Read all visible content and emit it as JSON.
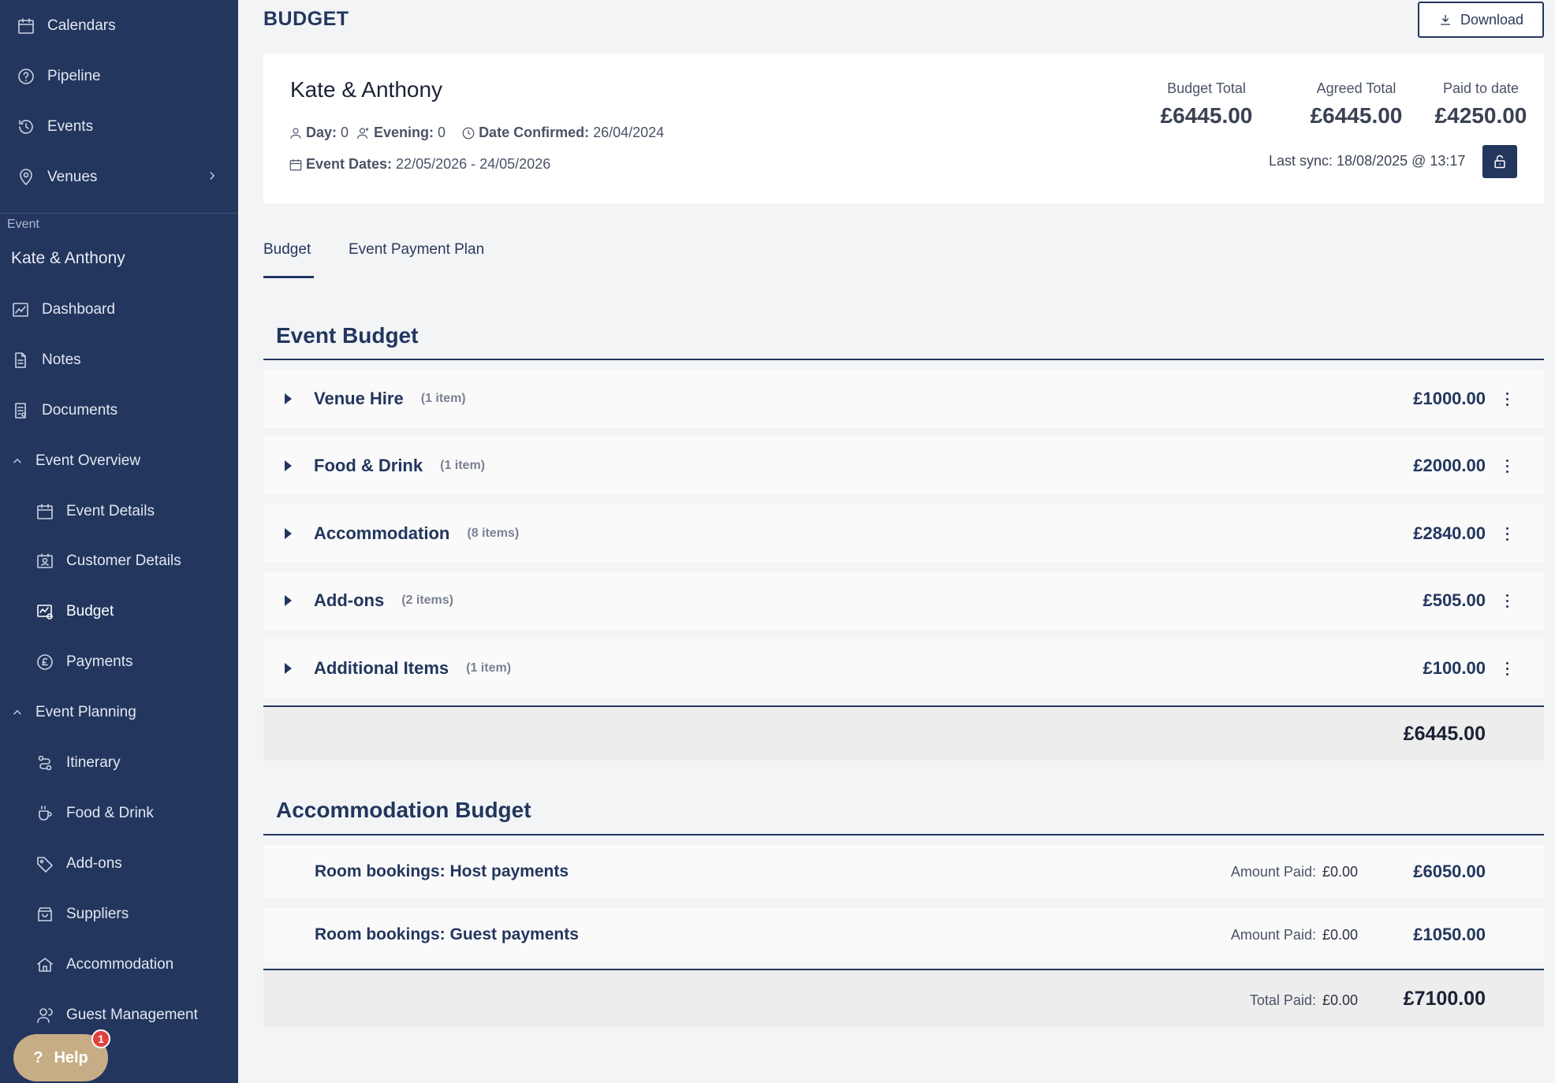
{
  "sidebar": {
    "top_items": [
      {
        "label": "Calendars",
        "icon": "calendar-icon"
      },
      {
        "label": "Pipeline",
        "icon": "question-circle-icon"
      },
      {
        "label": "Events",
        "icon": "history-icon"
      },
      {
        "label": "Venues",
        "icon": "location-pin-icon"
      }
    ],
    "section_label": "Event",
    "event_name": "Kate & Anthony",
    "event_items": [
      {
        "label": "Dashboard",
        "icon": "chart-icon"
      },
      {
        "label": "Notes",
        "icon": "note-icon"
      },
      {
        "label": "Documents",
        "icon": "document-icon"
      }
    ],
    "overview_group": "Event Overview",
    "overview_items": [
      {
        "label": "Event Details",
        "icon": "calendar-icon"
      },
      {
        "label": "Customer Details",
        "icon": "contact-card-icon"
      },
      {
        "label": "Budget",
        "icon": "budget-icon"
      },
      {
        "label": "Payments",
        "icon": "pound-coin-icon"
      }
    ],
    "planning_group": "Event Planning",
    "planning_items": [
      {
        "label": "Itinerary",
        "icon": "route-icon"
      },
      {
        "label": "Food & Drink",
        "icon": "cup-icon"
      },
      {
        "label": "Add-ons",
        "icon": "tag-icon"
      },
      {
        "label": "Suppliers",
        "icon": "store-icon"
      },
      {
        "label": "Accommodation",
        "icon": "home-icon"
      },
      {
        "label": "Guest Management",
        "icon": "users-icon"
      }
    ],
    "help_label": "Help",
    "help_badge": "1"
  },
  "header": {
    "title": "BUDGET",
    "download_label": "Download"
  },
  "summary": {
    "customer_name": "Kate & Anthony",
    "day_label": "Day:",
    "day_value": "0",
    "evening_label": "Evening:",
    "evening_value": "0",
    "date_confirmed_label": "Date Confirmed:",
    "date_confirmed_value": "26/04/2024",
    "event_dates_label": "Event Dates:",
    "event_dates_value": "22/05/2026 - 24/05/2026",
    "stats": [
      {
        "label": "Budget Total",
        "value": "£6445.00"
      },
      {
        "label": "Agreed Total",
        "value": "£6445.00"
      },
      {
        "label": "Paid to date",
        "value": "£4250.00"
      }
    ],
    "last_sync": "Last sync: 18/08/2025 @ 13:17"
  },
  "tabs": [
    {
      "label": "Budget"
    },
    {
      "label": "Event Payment Plan"
    }
  ],
  "event_budget": {
    "title": "Event Budget",
    "rows": [
      {
        "name": "Venue Hire",
        "count": "(1 item)",
        "amount": "£1000.00"
      },
      {
        "name": "Food & Drink",
        "count": "(1 item)",
        "amount": "£2000.00"
      },
      {
        "name": "Accommodation",
        "count": "(8 items)",
        "amount": "£2840.00"
      },
      {
        "name": "Add-ons",
        "count": "(2 items)",
        "amount": "£505.00"
      },
      {
        "name": "Additional Items",
        "count": "(1 item)",
        "amount": "£100.00"
      }
    ],
    "total": "£6445.00"
  },
  "accommodation_budget": {
    "title": "Accommodation Budget",
    "paid_label": "Amount Paid:",
    "rows": [
      {
        "name": "Room bookings: Host payments",
        "paid": "£0.00",
        "amount": "£6050.00"
      },
      {
        "name": "Room bookings: Guest payments",
        "paid": "£0.00",
        "amount": "£1050.00"
      }
    ],
    "total_paid_label": "Total Paid:",
    "total_paid": "£0.00",
    "total": "£7100.00"
  }
}
